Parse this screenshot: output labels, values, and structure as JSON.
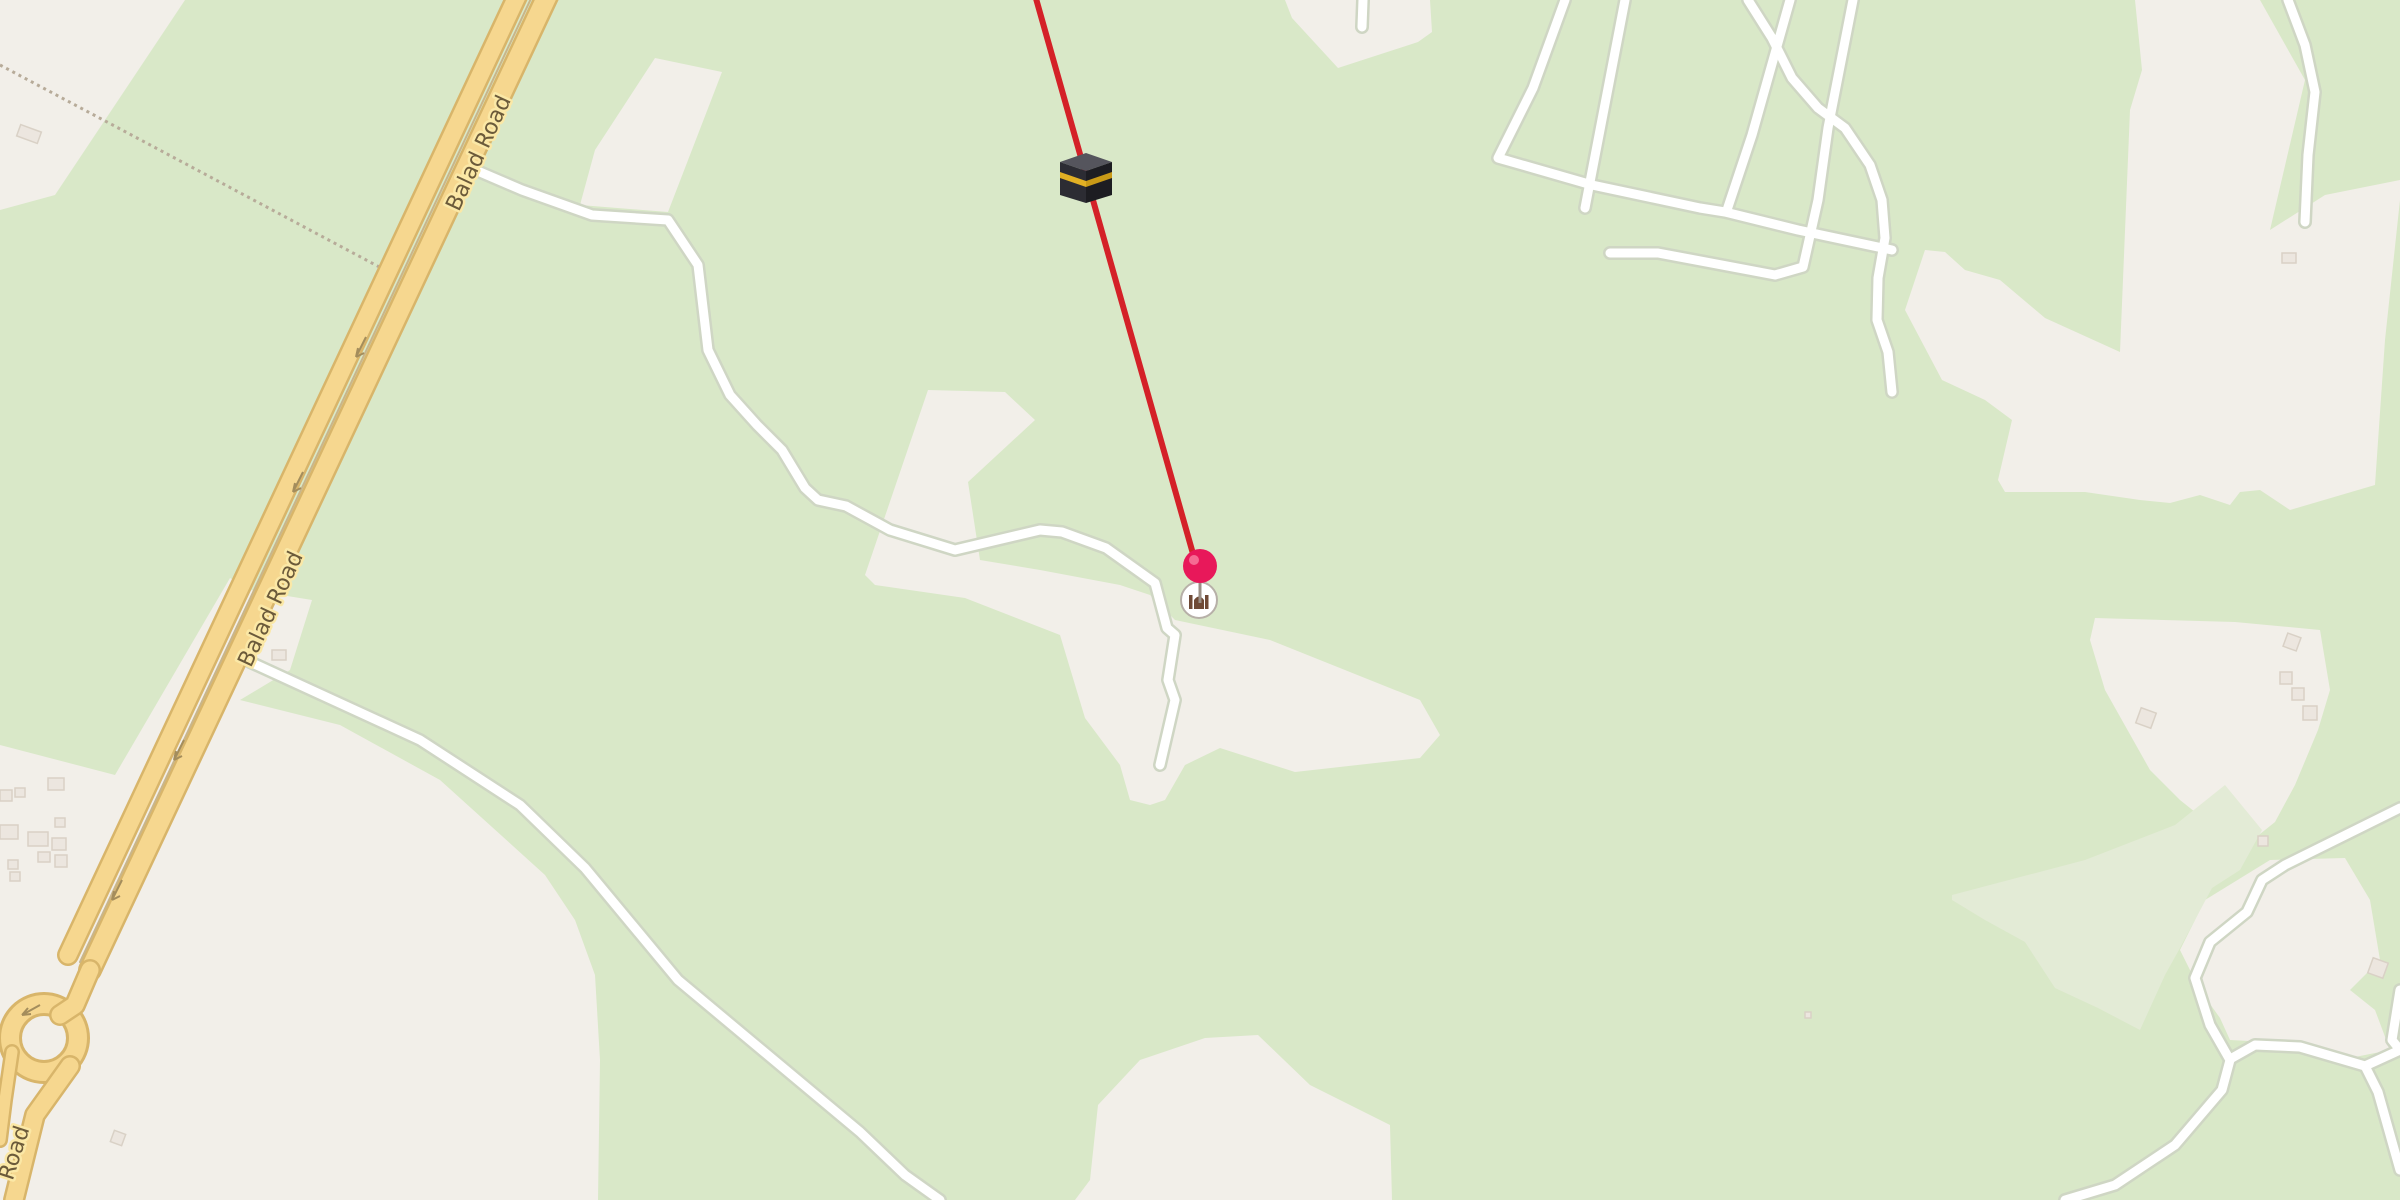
{
  "map": {
    "roads": [
      {
        "name": "Balad Road"
      },
      {
        "name": "Balad Road"
      },
      {
        "name": "Road"
      }
    ],
    "markers": {
      "destination_pin": {
        "icon": "map-pin-icon",
        "color": "#e8185a"
      },
      "mosque_poi": {
        "icon": "mosque-icon"
      },
      "kaaba": {
        "icon": "kaaba-icon"
      }
    },
    "qibla_line": {
      "color": "#d42128"
    },
    "colors": {
      "land": "#d9e8c8",
      "built_area": "#f2efe9",
      "meadow": "#e3ebd6",
      "major_road": "#f6d78f",
      "minor_road": "#ffffff"
    }
  }
}
